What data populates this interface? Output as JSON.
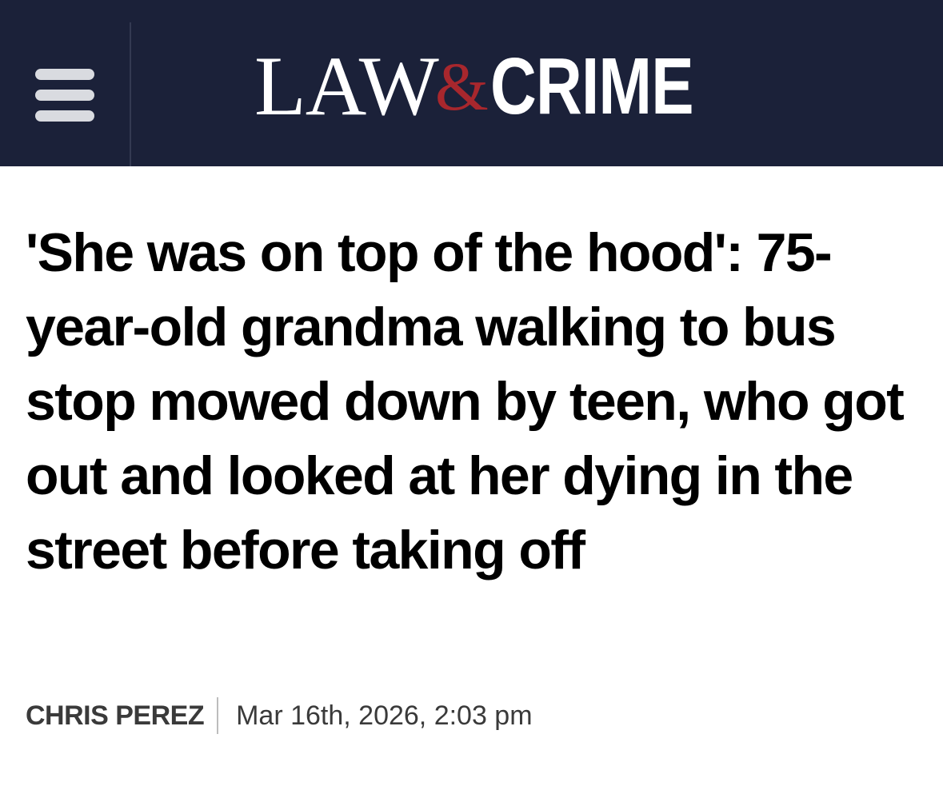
{
  "header": {
    "menu_icon": "hamburger-menu-icon",
    "logo": {
      "part1": "LAW",
      "ampersand": "&",
      "part2": "CRIME"
    },
    "colors": {
      "background": "#1b2139",
      "ampersand": "#a8272d"
    }
  },
  "article": {
    "title": "'She was on top of the hood': 75-year-old grandma walking to bus stop mowed down by teen, who got out and looked at her dying in the street before taking off",
    "author": "CHRIS PEREZ",
    "date": "Mar 16th, 2026, 2:03 pm"
  }
}
